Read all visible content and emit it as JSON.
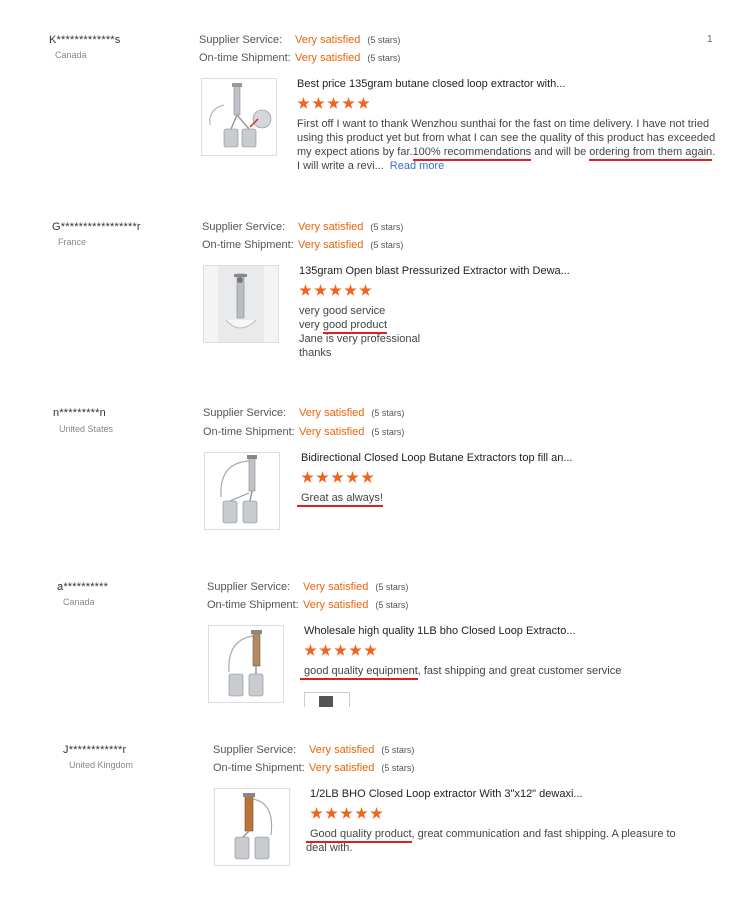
{
  "page_number": "1",
  "colors": {
    "accent": "#e8650a",
    "star": "#f0641e",
    "underline": "#e02020",
    "link": "#3a6fc4"
  },
  "labels": {
    "supplier_service": "Supplier Service:",
    "on_time_shipment": "On-time Shipment:"
  },
  "reviews": [
    {
      "buyer": "K*************s",
      "country": "Canada",
      "supplier_service": "Very satisfied",
      "supplier_service_note": "(5 stars)",
      "shipment": "Very satisfied",
      "shipment_note": "(5 stars)",
      "product_title": "Best price 135gram butane closed loop extractor with...",
      "stars": 5,
      "comment_parts": [
        "First off I want to thank Wenzhou sunthai for the fast on time delivery. I have not tried using this product yet but from what I can see the quality of this product has exceeded my expect ations by far.",
        "100% recommendations",
        " and will be ",
        "ordering from them again",
        ". I will write a revi..."
      ],
      "read_more": "Read more",
      "thumb_icon": "extractor-with-flask-icon"
    },
    {
      "buyer": "G*****************r",
      "country": "France",
      "supplier_service": "Very satisfied",
      "supplier_service_note": "(5 stars)",
      "shipment": "Very satisfied",
      "shipment_note": "(5 stars)",
      "product_title": "135gram Open blast Pressurized Extractor with Dewa...",
      "stars": 5,
      "comment_parts": [
        "very good service",
        "very ",
        "good product",
        "Jane is very professional",
        "thanks"
      ],
      "thumb_icon": "open-blast-extractor-icon"
    },
    {
      "buyer": "n*********n",
      "country": "United States",
      "supplier_service": "Very satisfied",
      "supplier_service_note": "(5 stars)",
      "shipment": "Very satisfied",
      "shipment_note": "(5 stars)",
      "product_title": "Bidirectional Closed Loop Butane Extractors top fill an...",
      "stars": 5,
      "comment_parts": [
        "Great as always!"
      ],
      "thumb_icon": "closed-loop-extractor-icon"
    },
    {
      "buyer": "a**********",
      "country": "Canada",
      "supplier_service": "Very satisfied",
      "supplier_service_note": "(5 stars)",
      "shipment": "Very satisfied",
      "shipment_note": "(5 stars)",
      "product_title": "Wholesale high quality 1LB bho Closed Loop Extracto...",
      "stars": 5,
      "comment_parts": [
        "good quality equipment",
        ", fast shipping and great customer service"
      ],
      "thumb_icon": "bho-extractor-icon"
    },
    {
      "buyer": "J************r",
      "country": "United Kingdom",
      "supplier_service": "Very satisfied",
      "supplier_service_note": "(5 stars)",
      "shipment": "Very satisfied",
      "shipment_note": "(5 stars)",
      "product_title": "1/2LB BHO Closed Loop extractor With 3\"x12\" dewaxi...",
      "stars": 5,
      "comment_parts": [
        "Good quality product",
        ", great communication and fast shipping. A pleasure to deal with."
      ],
      "thumb_icon": "copper-column-extractor-icon"
    }
  ]
}
